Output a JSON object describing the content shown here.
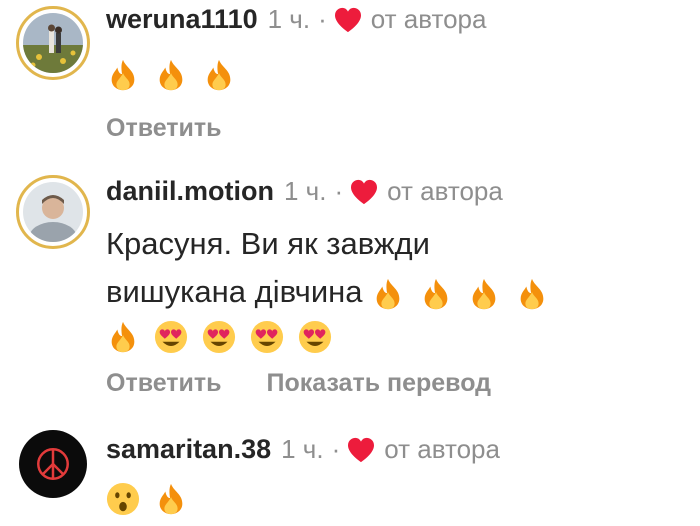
{
  "comments": [
    {
      "username": "weruna1110",
      "time": "1 ч.",
      "by_author": "от автора",
      "text_line1": "",
      "text_line2": "",
      "emojis": [
        "fire-emoji",
        "fire-emoji",
        "fire-emoji"
      ],
      "reply": "Ответить"
    },
    {
      "username": "daniil.motion",
      "time": "1 ч.",
      "by_author": "от автора",
      "text_line1": "Красуня. Ви як завжди",
      "text_line2": "вишукана дівчина",
      "emojis_line2": [
        "fire-emoji",
        "fire-emoji",
        "fire-emoji",
        "fire-emoji"
      ],
      "emojis_line3": [
        "fire-emoji",
        "heart-eyes-emoji",
        "heart-eyes-emoji",
        "heart-eyes-emoji",
        "heart-eyes-emoji"
      ],
      "reply": "Ответить",
      "translate": "Показать перевод"
    },
    {
      "username": "samaritan.38",
      "time": "1 ч.",
      "by_author": "от автора",
      "emojis": [
        "surprised-face-emoji",
        "fire-emoji"
      ]
    }
  ],
  "colors": {
    "heart": "#ed1c3c",
    "muted": "#8e8e8e",
    "text": "#262626",
    "story_ring": "#e1b64d"
  }
}
